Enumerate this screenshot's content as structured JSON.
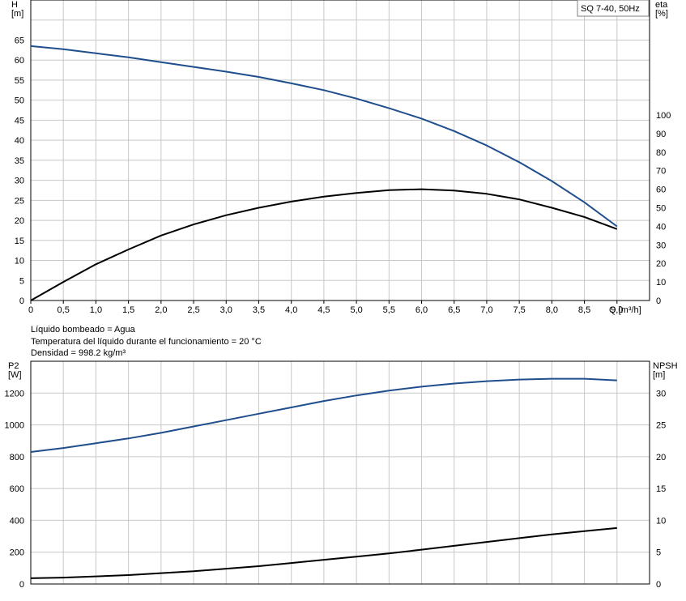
{
  "chart_data": [
    {
      "type": "line",
      "title": "SQ 7-40, 50Hz",
      "xlabel": "Q [m³/h]",
      "ylabel": "H\n[m]",
      "ylabel_right": "eta\n[%]",
      "xlim": [
        0,
        9.5
      ],
      "ylim": [
        0,
        75
      ],
      "ylim_right": [
        0,
        162
      ],
      "x_ticks": [
        "0",
        "0,5",
        "1,0",
        "1,5",
        "2,0",
        "2,5",
        "3,0",
        "3,5",
        "4,0",
        "4,5",
        "5,0",
        "5,5",
        "6,0",
        "6,5",
        "7,0",
        "7,5",
        "8,0",
        "8,5",
        "9,0"
      ],
      "y_ticks": [
        "0",
        "5",
        "10",
        "15",
        "20",
        "25",
        "30",
        "35",
        "40",
        "45",
        "50",
        "55",
        "60",
        "65"
      ],
      "y_ticks_right": [
        "0",
        "10",
        "20",
        "30",
        "40",
        "50",
        "60",
        "70",
        "80",
        "90",
        "100"
      ],
      "grid": true,
      "series": [
        {
          "axis": "left",
          "color": "#1f4e8c",
          "x": [
            0,
            0.5,
            1.0,
            1.5,
            2.0,
            2.5,
            3.0,
            3.5,
            4.0,
            4.5,
            5.0,
            5.5,
            6.0,
            6.5,
            7.0,
            7.5,
            8.0,
            8.5,
            9.0
          ],
          "y": [
            63.5,
            62.7,
            61.7,
            60.7,
            59.5,
            58.3,
            57.1,
            55.8,
            54.2,
            52.5,
            50.4,
            48.0,
            45.4,
            42.3,
            38.7,
            34.5,
            29.8,
            24.5,
            18.5
          ]
        },
        {
          "axis": "right",
          "color": "#000000",
          "x": [
            0,
            0.5,
            1.0,
            1.5,
            2.0,
            2.5,
            3.0,
            3.5,
            4.0,
            4.5,
            5.0,
            5.5,
            6.0,
            6.5,
            7.0,
            7.5,
            8.0,
            8.5,
            9.0
          ],
          "y": [
            0,
            10,
            19.5,
            27.5,
            35,
            41,
            46,
            50,
            53.3,
            56,
            58,
            59.5,
            60,
            59.3,
            57.5,
            54.5,
            50,
            45,
            38.5
          ]
        }
      ]
    },
    {
      "type": "line",
      "xlim": [
        0,
        9.5
      ],
      "ylabel": "P2\n[W]",
      "ylabel_right": "NPSH\n[m]",
      "ylim": [
        0,
        1400
      ],
      "ylim_right": [
        0,
        35
      ],
      "y_ticks": [
        "0",
        "200",
        "400",
        "600",
        "800",
        "1000",
        "1200"
      ],
      "y_ticks_right": [
        "0",
        "5",
        "10",
        "15",
        "20",
        "25",
        "30"
      ],
      "grid": true,
      "series": [
        {
          "axis": "left",
          "color": "#1f4e8c",
          "x": [
            0,
            0.5,
            1.0,
            1.5,
            2.0,
            2.5,
            3.0,
            3.5,
            4.0,
            4.5,
            5.0,
            5.5,
            6.0,
            6.5,
            7.0,
            7.5,
            8.0,
            8.5,
            9.0
          ],
          "y": [
            830,
            855,
            885,
            915,
            950,
            990,
            1030,
            1070,
            1110,
            1150,
            1185,
            1215,
            1240,
            1260,
            1275,
            1285,
            1290,
            1290,
            1280
          ]
        },
        {
          "axis": "right",
          "color": "#000000",
          "x": [
            0,
            0.5,
            1.0,
            1.5,
            2.0,
            2.5,
            3.0,
            3.5,
            4.0,
            4.5,
            5.0,
            5.5,
            6.0,
            6.5,
            7.0,
            7.5,
            8.0,
            8.5,
            9.0
          ],
          "y": [
            0.9,
            1.0,
            1.2,
            1.4,
            1.7,
            2.0,
            2.4,
            2.8,
            3.3,
            3.8,
            4.3,
            4.8,
            5.4,
            6.0,
            6.6,
            7.2,
            7.8,
            8.3,
            8.8
          ]
        }
      ]
    }
  ],
  "info_lines": [
    "Líquido bombeado = Agua",
    "Temperatura del líquido durante el funcionamiento = 20 °C",
    "Densidad = 998.2 kg/m³"
  ]
}
